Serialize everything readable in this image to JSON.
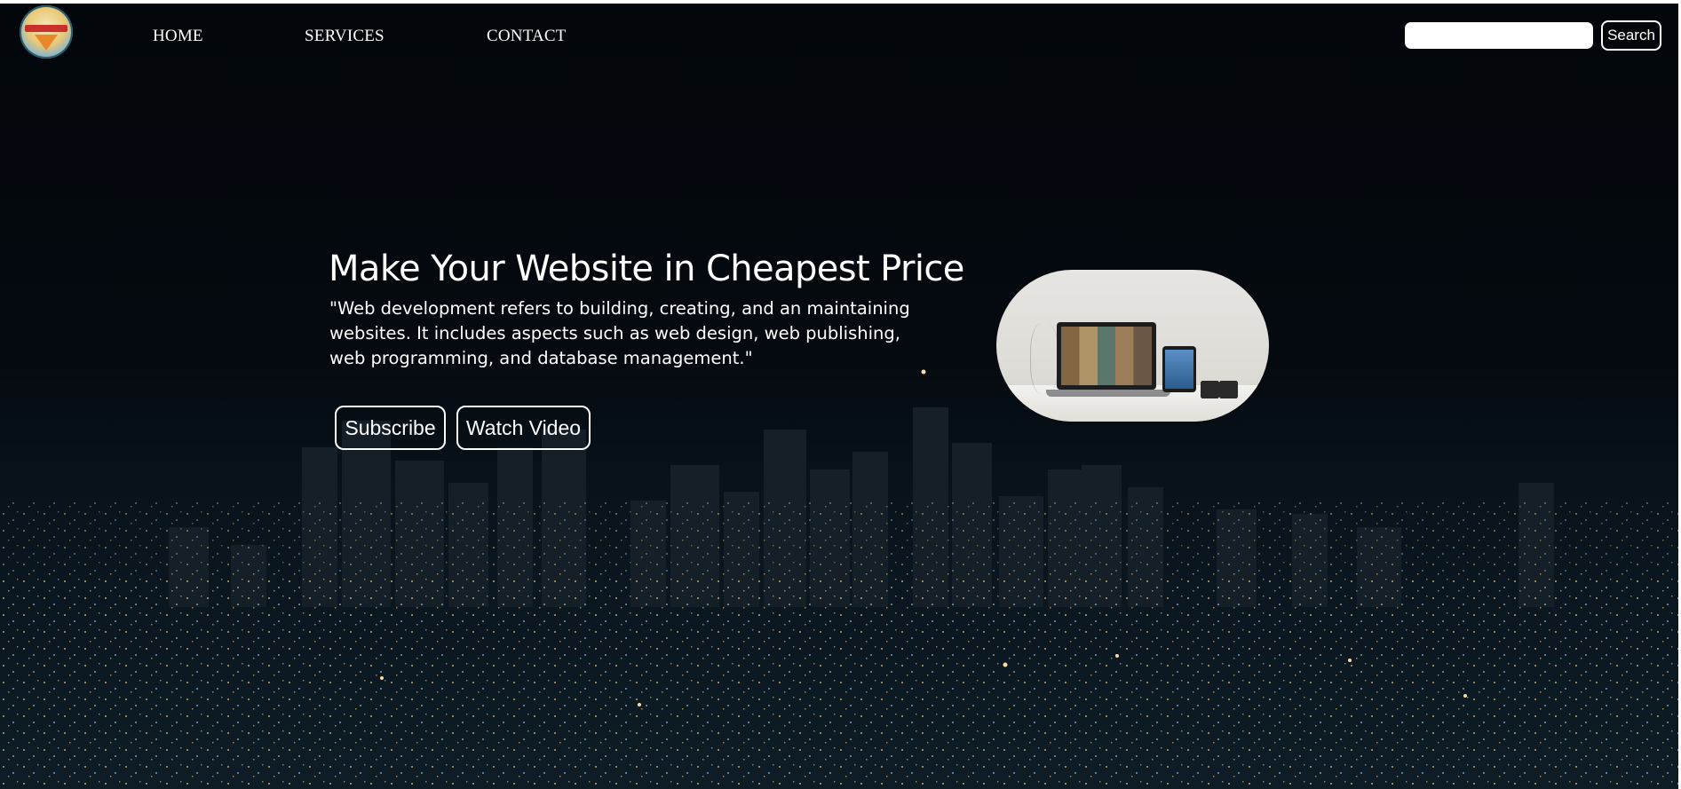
{
  "nav": {
    "links": [
      "HOME",
      "SERVICES",
      "CONTACT"
    ]
  },
  "search": {
    "placeholder": "",
    "value": "",
    "button_label": "Search"
  },
  "hero": {
    "title": "Make Your Website in Cheapest Price",
    "description": "\"Web development refers to building, creating, and an maintaining websites. It includes aspects such as web design, web publishing, web programming, and database management.\"",
    "buttons": [
      "Subscribe",
      "Watch Video"
    ]
  },
  "icons": {
    "logo": "brand-logo-icon",
    "hero_image": "laptop-tablet-desk-photo"
  },
  "colors": {
    "background": "#03070c",
    "text": "#ffffff",
    "button_border": "#ffffff"
  }
}
